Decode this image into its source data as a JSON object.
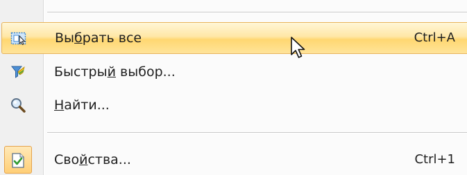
{
  "menu": {
    "items": [
      {
        "icon": "select-all-icon",
        "label_pre": "Вы",
        "label_ul": "б",
        "label_post": "рать все",
        "shortcut": "Ctrl+A",
        "state": "highlighted"
      },
      {
        "icon": "quick-select-funnel-icon",
        "label_pre": "Быстры",
        "label_ul": "й",
        "label_post": " выбор...",
        "shortcut": ""
      },
      {
        "icon": "magnifier-icon",
        "label_pre": "",
        "label_ul": "Н",
        "label_post": "айти...",
        "shortcut": ""
      },
      {
        "icon": "properties-checkmark-icon",
        "label_pre": "Сво",
        "label_ul": "й",
        "label_post": "ства...",
        "shortcut": "Ctrl+1",
        "state": "checked"
      }
    ]
  },
  "cursor": {
    "icon": "mouse-pointer-icon"
  },
  "colors": {
    "highlight_border": "#e8b35a",
    "highlight_top": "#fff6d6",
    "highlight_bottom": "#ffd771",
    "icon_strip": "#f0f0f0",
    "text": "#1e1e1e"
  }
}
